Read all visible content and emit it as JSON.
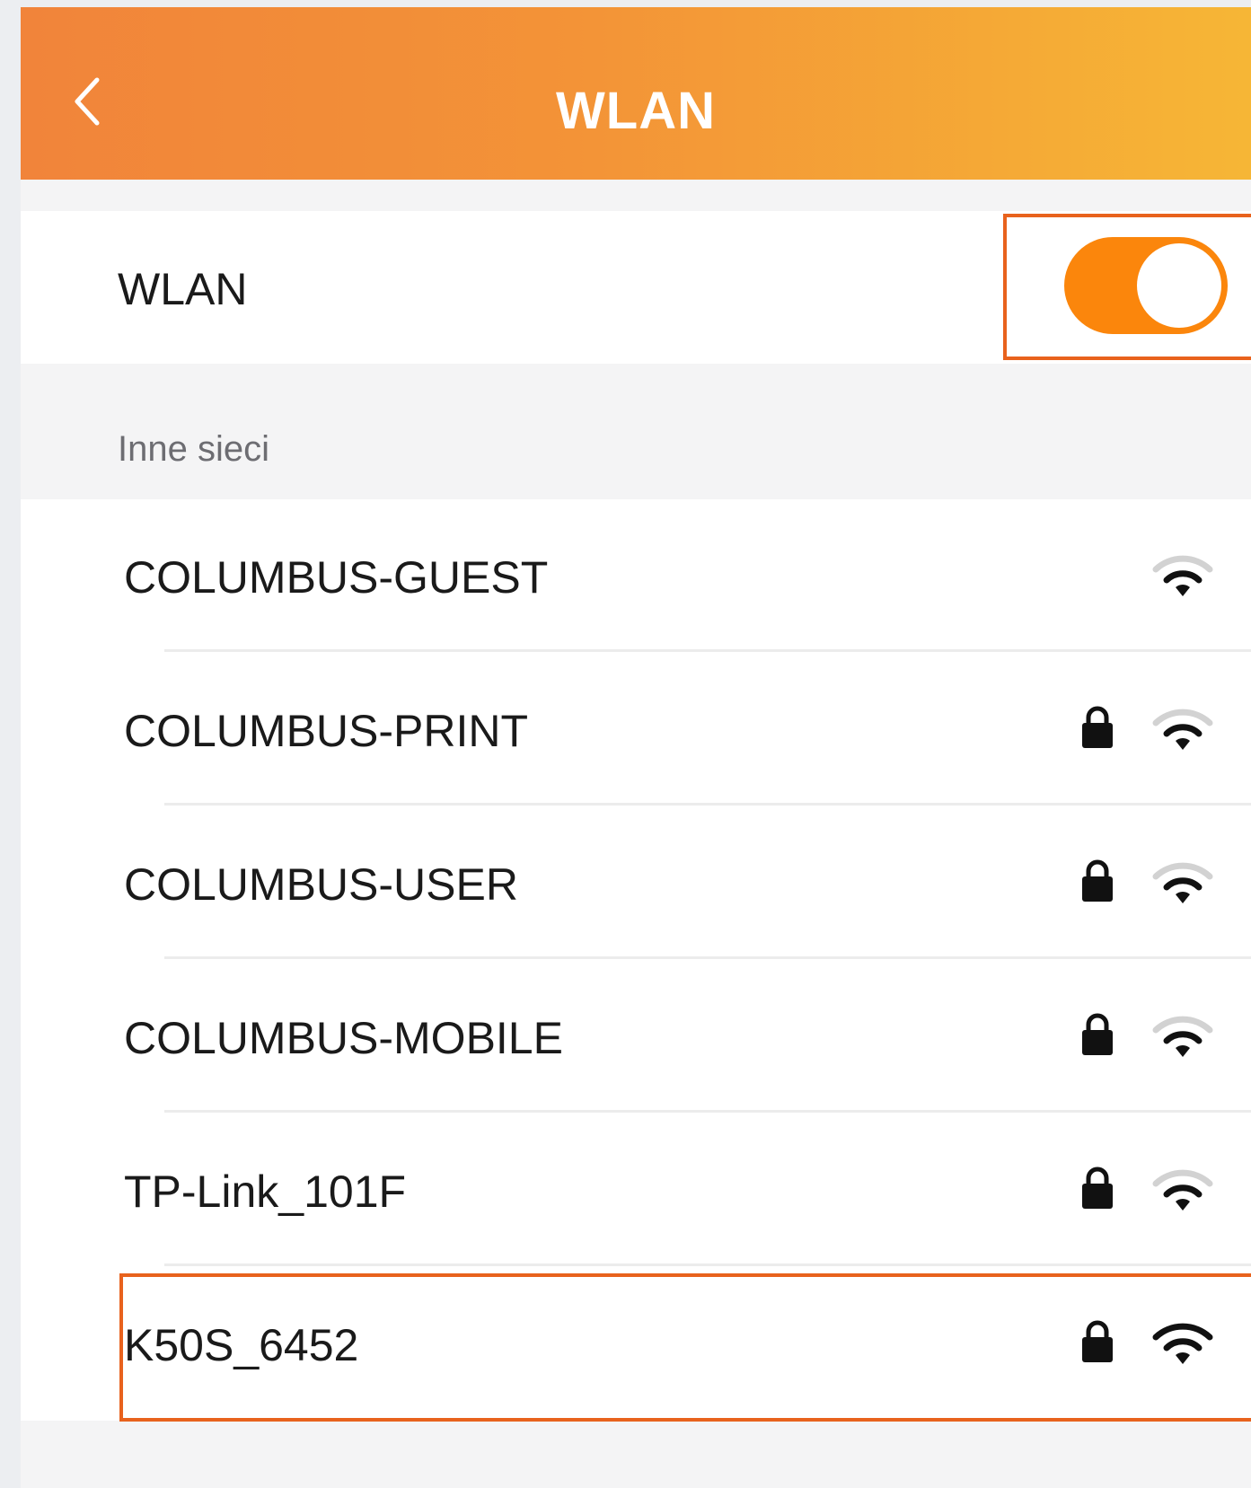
{
  "header": {
    "title": "WLAN",
    "back_icon": "chevron-left-icon"
  },
  "wlan_toggle": {
    "label": "WLAN",
    "on": true,
    "color": "#fb860c"
  },
  "section": {
    "label": "Inne sieci"
  },
  "networks": [
    {
      "name": "COLUMBUS-GUEST",
      "locked": false
    },
    {
      "name": "COLUMBUS-PRINT",
      "locked": true
    },
    {
      "name": "COLUMBUS-USER",
      "locked": true
    },
    {
      "name": "COLUMBUS-MOBILE",
      "locked": true
    },
    {
      "name": "TP-Link_101F",
      "locked": true
    },
    {
      "name": "K50S_6452",
      "locked": true
    }
  ],
  "colors": {
    "header_start": "#f1843a",
    "header_end": "#f6b636",
    "highlight": "#e8621d"
  }
}
